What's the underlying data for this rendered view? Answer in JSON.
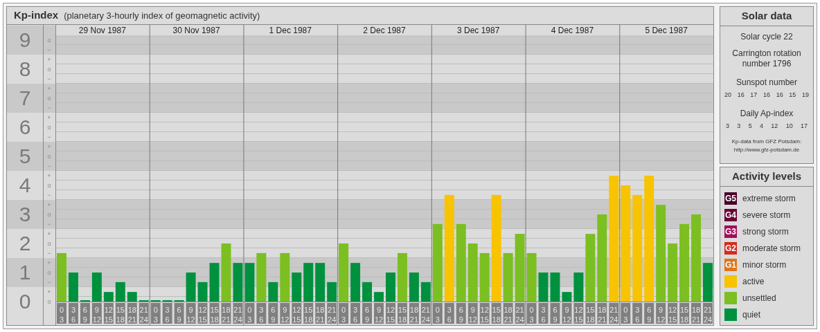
{
  "main_panel": {
    "title": "Kp-index",
    "subtitle": "(planetary 3-hourly index of geomagnetic activity)"
  },
  "y_subticks": [
    "o",
    "−",
    "+",
    "o",
    "−",
    "+",
    "o",
    "−",
    "+",
    "o",
    "−",
    "+",
    "o",
    "−",
    "+",
    "o",
    "−",
    "+",
    "o",
    "−",
    "+",
    "o",
    "−",
    "+",
    "o",
    "−",
    "+",
    "o"
  ],
  "days": [
    {
      "date": "29 Nov 1987",
      "slots": [
        [
          "0",
          "3"
        ],
        [
          "3",
          "6"
        ],
        [
          "6",
          "9"
        ],
        [
          "9",
          "12"
        ],
        [
          "12",
          "15"
        ],
        [
          "15",
          "18"
        ],
        [
          "18",
          "21"
        ],
        [
          "21",
          "24"
        ]
      ]
    },
    {
      "date": "30 Nov 1987",
      "slots": [
        [
          "0",
          "3"
        ],
        [
          "3",
          "6"
        ],
        [
          "6",
          "9"
        ],
        [
          "9",
          "12"
        ],
        [
          "12",
          "15"
        ],
        [
          "15",
          "18"
        ],
        [
          "18",
          "21"
        ],
        [
          "21",
          "24"
        ]
      ]
    },
    {
      "date": "1 Dec 1987",
      "slots": [
        [
          "0",
          "3"
        ],
        [
          "3",
          "6"
        ],
        [
          "6",
          "9"
        ],
        [
          "9",
          "12"
        ],
        [
          "12",
          "15"
        ],
        [
          "15",
          "18"
        ],
        [
          "18",
          "21"
        ],
        [
          "21",
          "24"
        ]
      ]
    },
    {
      "date": "2 Dec 1987",
      "slots": [
        [
          "0",
          "3"
        ],
        [
          "3",
          "6"
        ],
        [
          "6",
          "9"
        ],
        [
          "9",
          "12"
        ],
        [
          "12",
          "15"
        ],
        [
          "15",
          "18"
        ],
        [
          "18",
          "21"
        ],
        [
          "21",
          "24"
        ]
      ]
    },
    {
      "date": "3 Dec 1987",
      "slots": [
        [
          "0",
          "3"
        ],
        [
          "3",
          "6"
        ],
        [
          "6",
          "9"
        ],
        [
          "9",
          "12"
        ],
        [
          "12",
          "15"
        ],
        [
          "15",
          "18"
        ],
        [
          "18",
          "21"
        ],
        [
          "21",
          "24"
        ]
      ]
    },
    {
      "date": "4 Dec 1987",
      "slots": [
        [
          "0",
          "3"
        ],
        [
          "3",
          "6"
        ],
        [
          "6",
          "9"
        ],
        [
          "9",
          "12"
        ],
        [
          "12",
          "15"
        ],
        [
          "15",
          "18"
        ],
        [
          "18",
          "21"
        ],
        [
          "21",
          "24"
        ]
      ]
    },
    {
      "date": "5 Dec 1987",
      "slots": [
        [
          "0",
          "3"
        ],
        [
          "3",
          "6"
        ],
        [
          "6",
          "9"
        ],
        [
          "9",
          "12"
        ],
        [
          "12",
          "15"
        ],
        [
          "15",
          "18"
        ],
        [
          "18",
          "21"
        ],
        [
          "21",
          "24"
        ]
      ]
    }
  ],
  "chart_data": {
    "type": "bar",
    "ylim": [
      0,
      9
    ],
    "yticks": [
      0,
      1,
      2,
      3,
      4,
      5,
      6,
      7,
      8,
      9
    ],
    "grid": true,
    "series": [
      {
        "name": "quiet",
        "color": "#00913f",
        "values": [
          null,
          1,
          0,
          1,
          0.33,
          0.67,
          0.33,
          0,
          0,
          0,
          0,
          1,
          0.67,
          1.33,
          null,
          1.33,
          1.33,
          null,
          0.67,
          null,
          1,
          1.33,
          1.33,
          0.67,
          null,
          1.33,
          0.67,
          0.33,
          1,
          null,
          1,
          0.67,
          null,
          null,
          null,
          null,
          null,
          null,
          null,
          null,
          null,
          1,
          1,
          0.33,
          1,
          null,
          null,
          null,
          null,
          null,
          null,
          null,
          null,
          null,
          null,
          1.33
        ]
      },
      {
        "name": "unsettled",
        "color": "#7bbf21",
        "values": [
          1.67,
          null,
          null,
          null,
          null,
          null,
          null,
          null,
          null,
          null,
          null,
          null,
          null,
          null,
          2,
          null,
          null,
          1.67,
          null,
          1.67,
          null,
          null,
          null,
          null,
          2,
          null,
          null,
          null,
          null,
          1.67,
          null,
          null,
          2.67,
          null,
          2.67,
          2,
          1.67,
          null,
          1.67,
          2.33,
          1.67,
          null,
          null,
          null,
          null,
          2.33,
          3,
          null,
          null,
          null,
          null,
          3.33,
          2,
          2.67,
          3,
          null
        ]
      },
      {
        "name": "active",
        "color": "#f8c300",
        "values": [
          null,
          null,
          null,
          null,
          null,
          null,
          null,
          null,
          null,
          null,
          null,
          null,
          null,
          null,
          null,
          null,
          null,
          null,
          null,
          null,
          null,
          null,
          null,
          null,
          null,
          null,
          null,
          null,
          null,
          null,
          null,
          null,
          null,
          3.67,
          null,
          null,
          null,
          3.67,
          null,
          null,
          null,
          null,
          null,
          null,
          null,
          null,
          null,
          4.33,
          4,
          3.67,
          4.33,
          null,
          null,
          null,
          null,
          null
        ]
      }
    ]
  },
  "solar_data": {
    "title": "Solar data",
    "solar_cycle": "Solar cycle 22",
    "carrington": "Carrington rotation number 1796",
    "sunspot_title": "Sunspot number",
    "sunspot_numbers": [
      "20",
      "16",
      "17",
      "16",
      "16",
      "15",
      "19"
    ],
    "ap_title": "Daily Ap-index",
    "ap_values": [
      "3",
      "3",
      "5",
      "4",
      "12",
      "10",
      "17"
    ],
    "source": "Kp-data from GFZ Potsdam:",
    "source_link": "http://www.gfz-potsdam.de"
  },
  "activity_levels": {
    "title": "Activity levels",
    "items": [
      {
        "badge": "G5",
        "label": "extreme storm",
        "color": "#4a0026"
      },
      {
        "badge": "G4",
        "label": "severe storm",
        "color": "#6b0039"
      },
      {
        "badge": "G3",
        "label": "strong storm",
        "color": "#a30d5c"
      },
      {
        "badge": "G2",
        "label": "moderate storm",
        "color": "#d42b1c"
      },
      {
        "badge": "G1",
        "label": "minor storm",
        "color": "#e0761c"
      }
    ]
  }
}
